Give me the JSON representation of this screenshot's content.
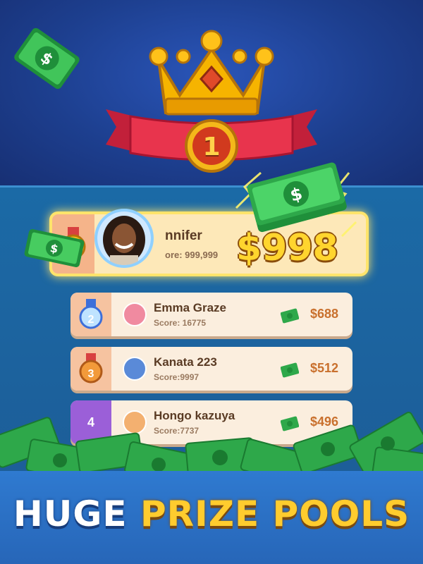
{
  "banner": {
    "part1": "HUGE",
    "part2": "PRIZE POOLS"
  },
  "first_place": {
    "rank_badge": "1",
    "name": "nnifer",
    "score": "ore: 999,999",
    "prize": "$998"
  },
  "leaderboard": [
    {
      "rank": "2",
      "name": "Emma Graze",
      "score": "Score: 16775",
      "prize": "$688",
      "badge": "silver-medal-icon"
    },
    {
      "rank": "3",
      "name": "Kanata 223",
      "score": "Score:9997",
      "prize": "$512",
      "badge": "bronze-medal-icon"
    },
    {
      "rank": "4",
      "name": "Hongo kazuya",
      "score": "Score:7737",
      "prize": "$496",
      "badge": "rank-number"
    }
  ],
  "colors": {
    "gold": "#ffcc2e",
    "panel": "#fbeede",
    "prize_text": "#c9702d",
    "purple_rank": "#9b5fd8"
  }
}
